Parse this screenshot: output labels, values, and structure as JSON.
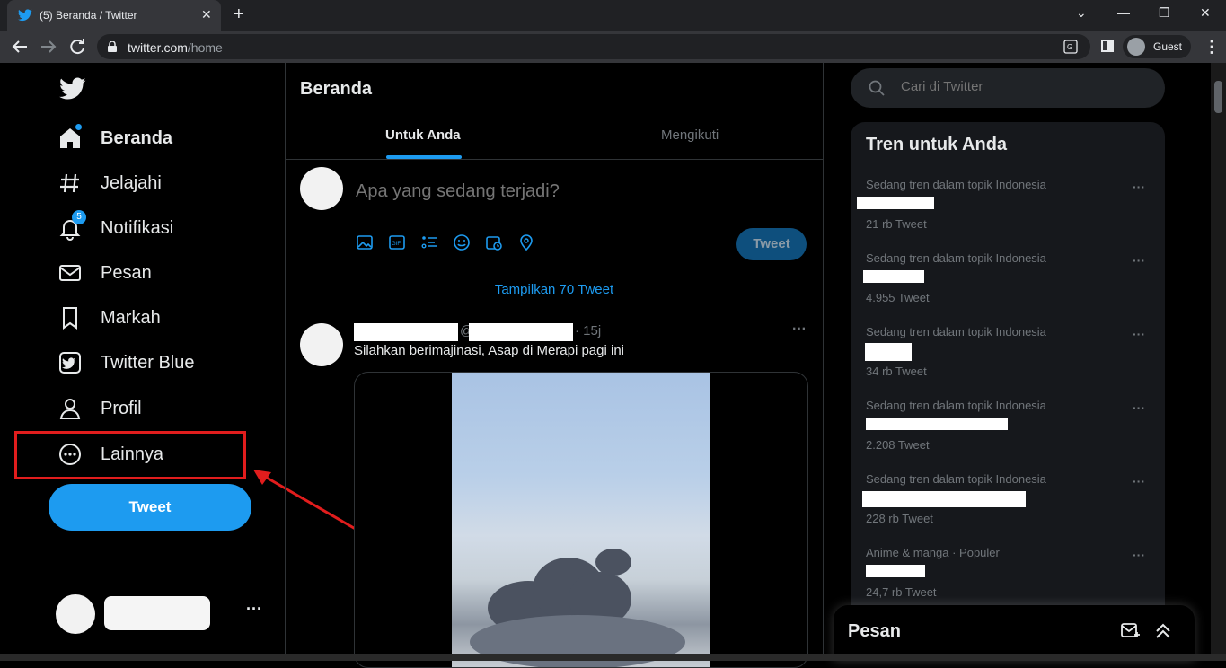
{
  "browser": {
    "tab_title": "(5) Beranda / Twitter",
    "tab_close": "✕",
    "new_tab": "+",
    "url_domain": "twitter.com",
    "url_path": "/home",
    "guest_label": "Guest",
    "win_min": "⌄",
    "win_minimize": "—",
    "win_restore": "❐",
    "win_close": "✕",
    "menu": "⋮"
  },
  "nav": {
    "items": [
      {
        "label": "Beranda",
        "icon": "home-icon",
        "active": true
      },
      {
        "label": "Jelajahi",
        "icon": "hashtag-icon"
      },
      {
        "label": "Notifikasi",
        "icon": "bell-icon",
        "badge": "5"
      },
      {
        "label": "Pesan",
        "icon": "envelope-icon"
      },
      {
        "label": "Markah",
        "icon": "bookmark-icon"
      },
      {
        "label": "Twitter Blue",
        "icon": "twitter-blue-icon"
      },
      {
        "label": "Profil",
        "icon": "person-icon"
      },
      {
        "label": "Lainnya",
        "icon": "more-circle-icon"
      }
    ],
    "tweet_button": "Tweet",
    "account_more": "···"
  },
  "main": {
    "title": "Beranda",
    "tabs": [
      "Untuk Anda",
      "Mengikuti"
    ],
    "compose_placeholder": "Apa yang sedang terjadi?",
    "compose_button": "Tweet",
    "show_tweets": "Tampilkan 70 Tweet",
    "tweet": {
      "handle_prefix": "@",
      "time": "· 15j",
      "text": "Silahkan berimajinasi, Asap di Merapi pagi ini",
      "more": "···"
    }
  },
  "right": {
    "search_placeholder": "Cari di Twitter",
    "trends_title": "Tren untuk Anda",
    "trends": [
      {
        "category": "Sedang tren dalam topik Indonesia",
        "count": "21 rb Tweet"
      },
      {
        "category": "Sedang tren dalam topik Indonesia",
        "count": "4.955 Tweet"
      },
      {
        "category": "Sedang tren dalam topik Indonesia",
        "count": "34 rb Tweet"
      },
      {
        "category": "Sedang tren dalam topik Indonesia",
        "count": "2.208 Tweet"
      },
      {
        "category": "Sedang tren dalam topik Indonesia",
        "count": "228 rb Tweet"
      },
      {
        "category": "Anime & manga · Populer",
        "count": "24,7 rb Tweet"
      }
    ],
    "trend_more": "···",
    "dm_title": "Pesan"
  },
  "colors": {
    "accent": "#1d9bf0",
    "highlight": "#e11d1d",
    "background": "#000000"
  }
}
